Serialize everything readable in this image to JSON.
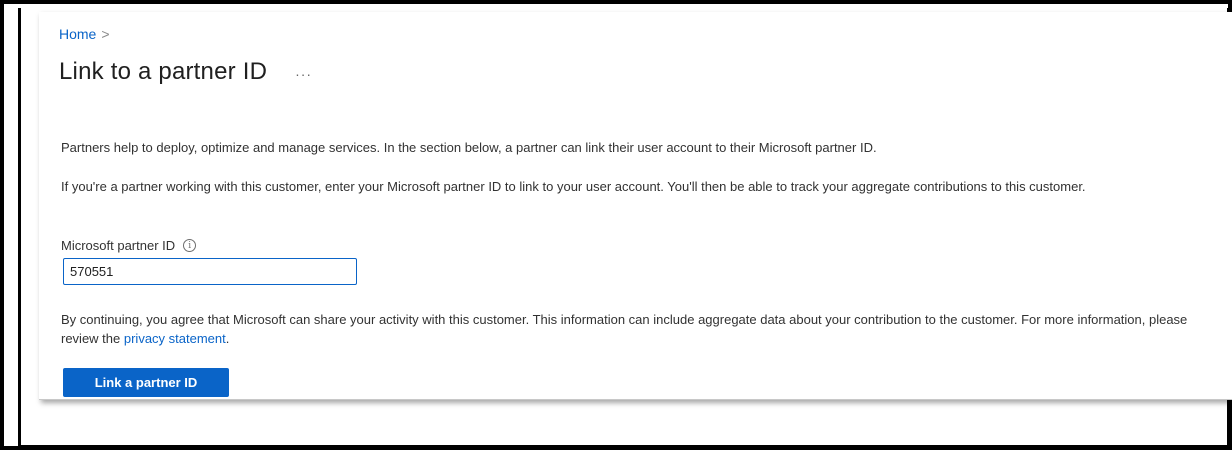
{
  "breadcrumb": {
    "home_label": "Home",
    "separator": ">"
  },
  "header": {
    "title": "Link to a partner ID",
    "more_label": "···"
  },
  "main": {
    "intro_text": "Partners help to deploy, optimize and manage services. In the section below, a partner can link their user account to their Microsoft partner ID.",
    "instruction_text": "If you're a partner working with this customer, enter your Microsoft partner ID to link to your user account. You'll then be able to track your aggregate contributions to this customer.",
    "field": {
      "label": "Microsoft partner ID",
      "info_glyph": "i",
      "value": "570551"
    },
    "consent": {
      "text_before_link": "By continuing, you agree that Microsoft can share your activity with this customer. This information can include aggregate data about your contribution to the customer. For more information, please review the ",
      "link_label": "privacy statement",
      "text_after_link": "."
    },
    "submit_label": "Link a partner ID"
  },
  "colors": {
    "accent": "#0a64c8",
    "text": "#323232",
    "title": "#202020"
  },
  "icons": {
    "breadcrumb_separator": "chevron-right-icon",
    "more": "more-icon",
    "info": "info-icon"
  }
}
